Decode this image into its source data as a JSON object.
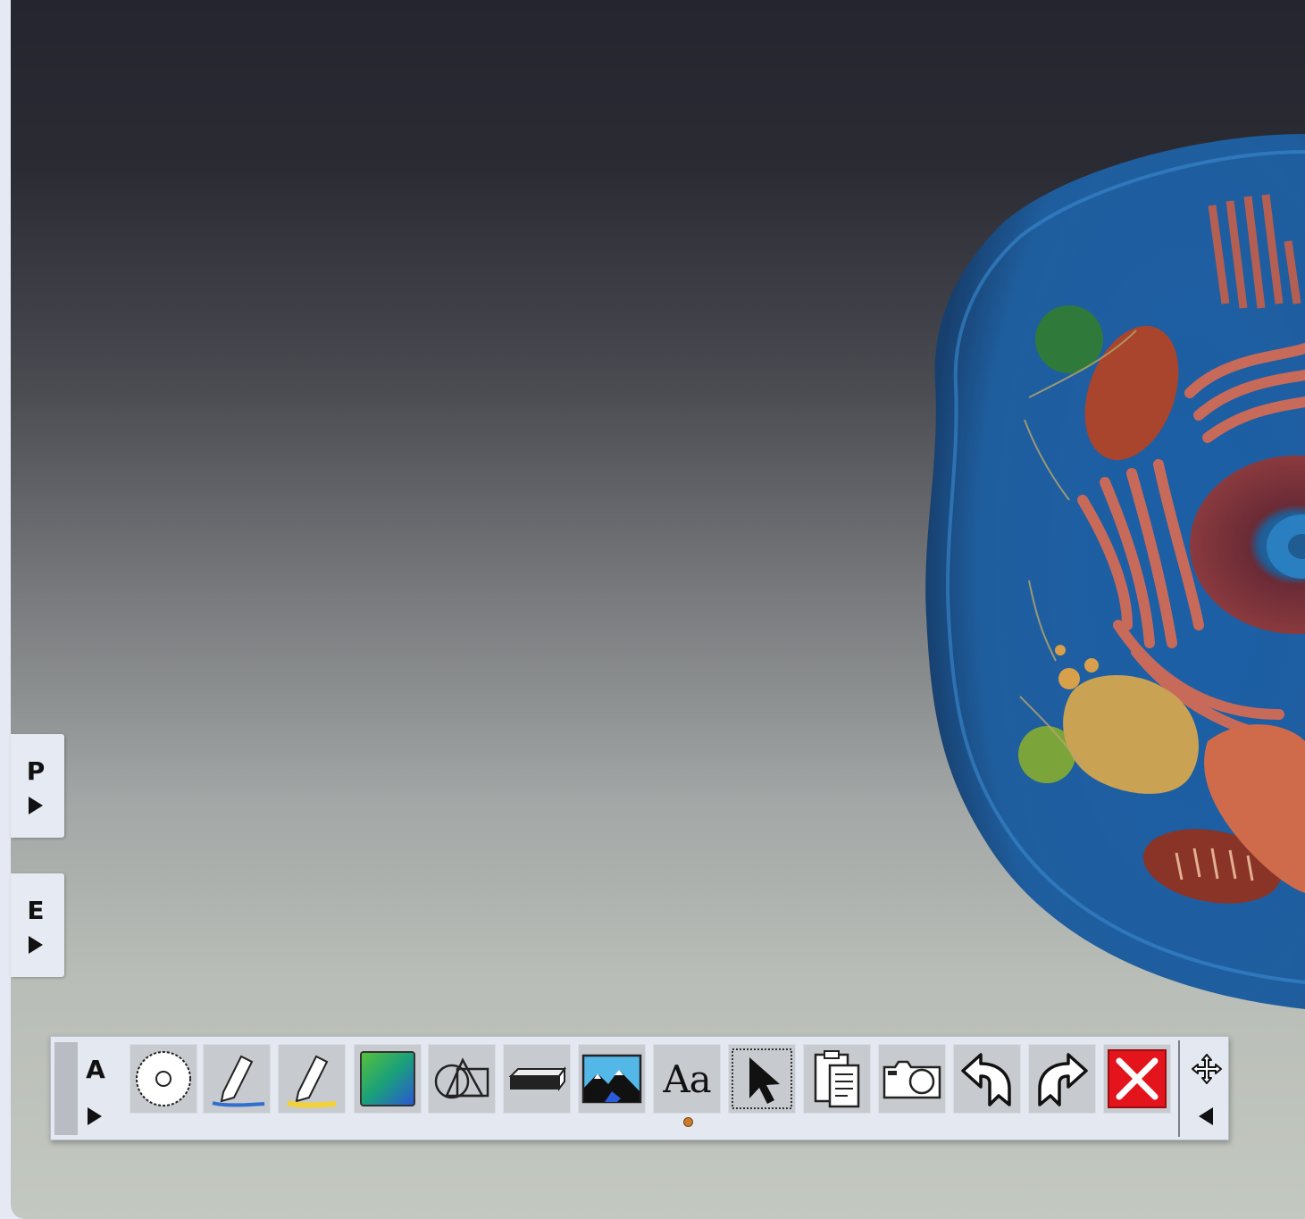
{
  "side_tabs": [
    {
      "letter": "P"
    },
    {
      "letter": "E"
    }
  ],
  "toolbar": {
    "letter": "A",
    "tools": [
      {
        "icon": "saw-blade-icon"
      },
      {
        "icon": "pen-icon",
        "color": "#2f6fd0"
      },
      {
        "icon": "highlighter-icon",
        "color": "#f2d23a"
      },
      {
        "icon": "color-picker-icon"
      },
      {
        "icon": "shapes-icon"
      },
      {
        "icon": "eraser-icon"
      },
      {
        "icon": "image-icon"
      },
      {
        "icon": "text-icon",
        "label": "Aa"
      },
      {
        "icon": "select-cursor-icon"
      },
      {
        "icon": "clipboard-icon"
      },
      {
        "icon": "camera-icon"
      },
      {
        "icon": "undo-icon"
      },
      {
        "icon": "redo-icon"
      },
      {
        "icon": "close-icon",
        "color": "#e3141b"
      }
    ]
  }
}
